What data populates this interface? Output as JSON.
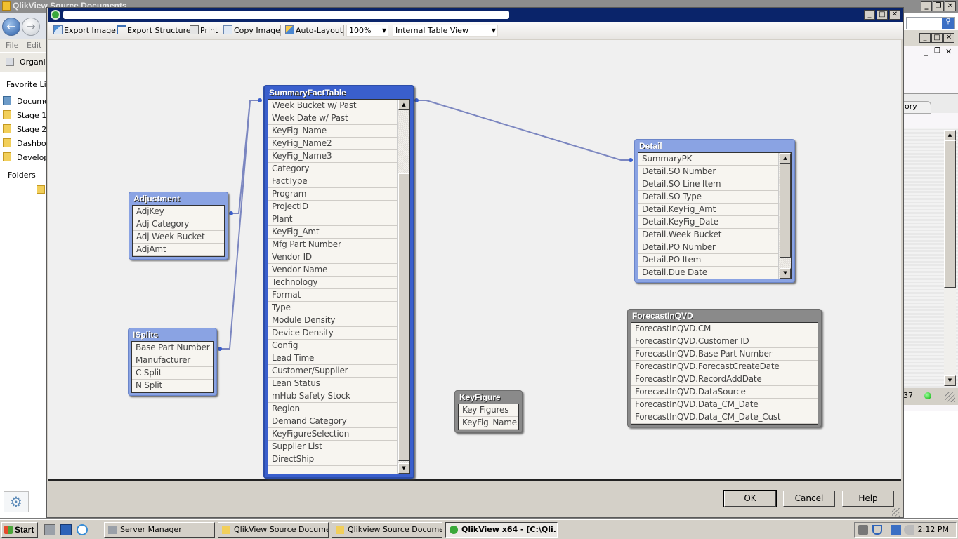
{
  "background_window": {
    "title": "QlikView Source Documents",
    "menu": [
      "File",
      "Edit"
    ],
    "organize_label": "Organize",
    "favorites_header": "Favorite Links",
    "favorites": [
      "Documents",
      "Stage 1",
      "Stage 2",
      "Dashboards",
      "Development"
    ],
    "folders_label": "Folders",
    "right_tab_label": "ory",
    "status_text": "37"
  },
  "dialog": {
    "title": "[redacted path]",
    "toolbar": {
      "export_image": "Export Image",
      "export_structure": "Export Structure",
      "print": "Print",
      "copy_image": "Copy Image",
      "auto_layout": "Auto-Layout",
      "zoom_value": "100%",
      "view_value": "Internal Table View"
    },
    "tables": {
      "summary": {
        "name": "SummaryFactTable",
        "fields": [
          "Week Bucket w/ Past",
          "Week Date w/ Past",
          "KeyFig_Name",
          "KeyFig_Name2",
          "KeyFig_Name3",
          "Category",
          "FactType",
          "Program",
          "ProjectID",
          "Plant",
          "KeyFig_Amt",
          "Mfg Part Number",
          "Vendor ID",
          "Vendor Name",
          "Technology",
          "Format",
          "Type",
          "Module Density",
          "Device Density",
          "Config",
          "Lead Time",
          "Customer/Supplier",
          "Lean Status",
          "mHub Safety Stock",
          "Region",
          "Demand Category",
          "KeyFigureSelection",
          "Supplier List",
          "DirectShip"
        ]
      },
      "adjustment": {
        "name": "Adjustment",
        "fields": [
          "AdjKey",
          "Adj Category",
          "Adj Week Bucket",
          "AdjAmt"
        ]
      },
      "isplits": {
        "name": "ISplits",
        "fields": [
          "Base Part Number",
          "Manufacturer",
          "C Split",
          "N Split"
        ]
      },
      "detail": {
        "name": "Detail",
        "fields": [
          "SummaryPK",
          "Detail.SO Number",
          "Detail.SO Line Item",
          "Detail.SO Type",
          "Detail.KeyFig_Amt",
          "Detail.KeyFig_Date",
          "Detail.Week Bucket",
          "Detail.PO Number",
          "Detail.PO Item",
          "Detail.Due Date"
        ]
      },
      "keyfigure": {
        "name": "KeyFigure",
        "fields": [
          "Key Figures",
          "KeyFig_Name"
        ]
      },
      "forecast": {
        "name": "ForecastInQVD",
        "fields": [
          "ForecastInQVD.CM",
          "ForecastInQVD.Customer ID",
          "ForecastInQVD.Base Part Number",
          "ForecastInQVD.ForecastCreateDate",
          "ForecastInQVD.RecordAddDate",
          "ForecastInQVD.DataSource",
          "ForecastInQVD.Data_CM_Date",
          "ForecastInQVD.Data_CM_Date_Cust"
        ]
      }
    },
    "buttons": {
      "ok": "OK",
      "cancel": "Cancel",
      "help": "Help"
    }
  },
  "taskbar": {
    "start": "Start",
    "tasks": [
      "Server Manager",
      "QlikView Source Documents",
      "Qlikview Source Docume...",
      "QlikView x64 - [C:\\Qli..."
    ],
    "clock": "2:12 PM"
  }
}
